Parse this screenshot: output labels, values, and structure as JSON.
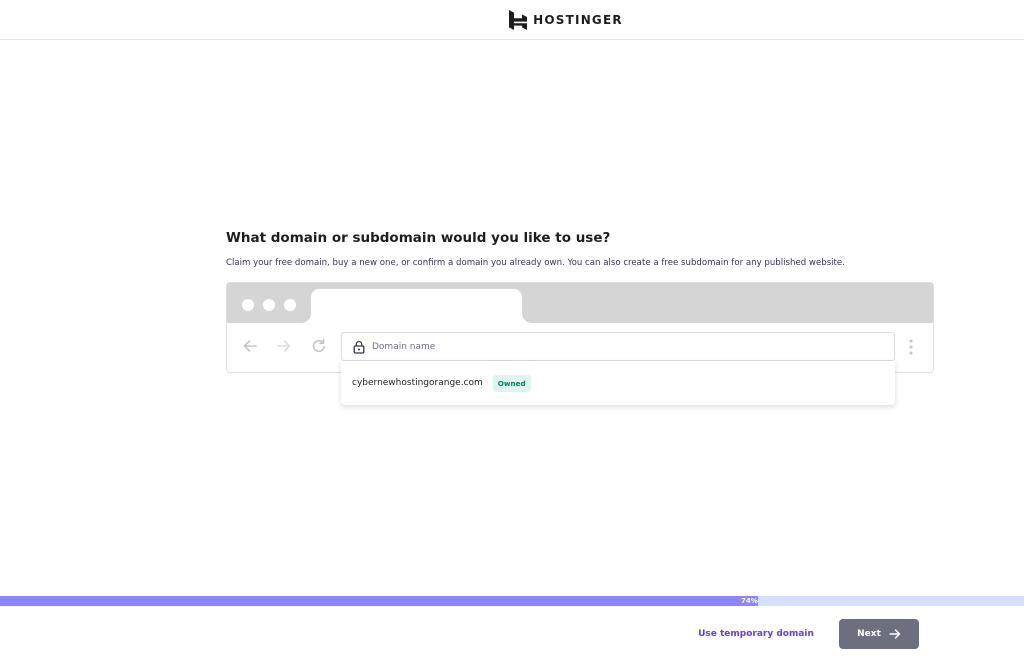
{
  "header": {
    "logo_text": "HOSTINGER",
    "logo_icon": "hostinger-logo-icon"
  },
  "main": {
    "title": "What domain or subdomain would you like to use?",
    "subtitle": "Claim your free domain, buy a new one, or confirm a domain you already own. You can also create a free subdomain for any published website."
  },
  "browser": {
    "icons": [
      "back-arrow-icon",
      "forward-arrow-icon",
      "reload-icon",
      "more-vertical-icon"
    ]
  },
  "domain_input": {
    "placeholder": "Domain name",
    "value": "",
    "icon": "lock-icon"
  },
  "suggestions": [
    {
      "domain": "cybernewhostingorange.com",
      "badge": "Owned"
    }
  ],
  "progress": {
    "percent": 74,
    "label": "74%"
  },
  "footer": {
    "temp_domain_label": "Use temporary domain",
    "next_label": "Next",
    "next_icon": "arrow-right-icon"
  },
  "colors": {
    "accent": "#673de6",
    "progress_fill": "#8c85ff",
    "progress_track": "#d5dfff",
    "next_button": "#6b6f7e",
    "owned_badge_bg": "#def4f0",
    "owned_badge_text": "#00825c"
  }
}
